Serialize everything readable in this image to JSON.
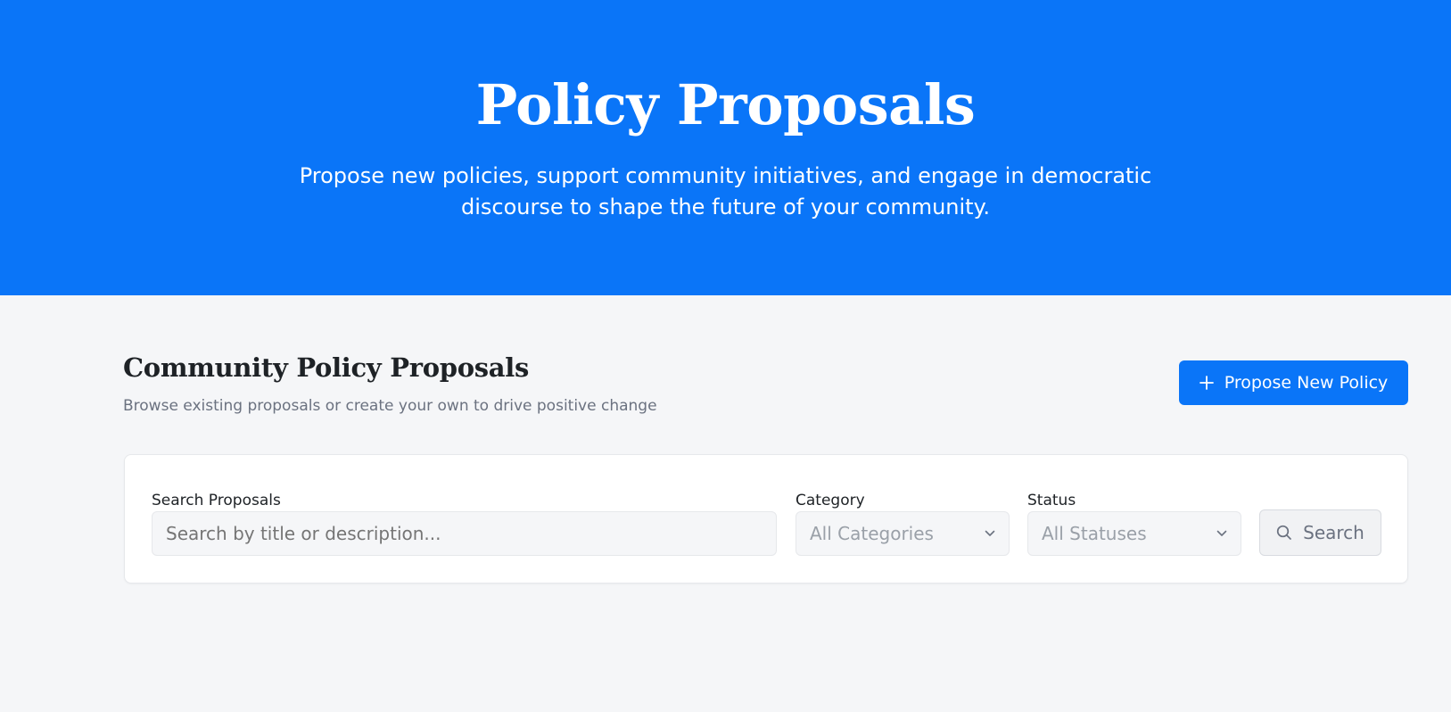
{
  "hero": {
    "title": "Policy Proposals",
    "subtitle": "Propose new policies, support community initiatives, and engage in democratic discourse to shape the future of your community.",
    "background_color": "#0a75f8"
  },
  "section": {
    "title": "Community Policy Proposals",
    "subtitle": "Browse existing proposals or create your own to drive positive change"
  },
  "propose_button": {
    "label": "Propose New Policy",
    "icon": "plus-icon"
  },
  "filters": {
    "search": {
      "label": "Search Proposals",
      "placeholder": "Search by title or description...",
      "value": ""
    },
    "category": {
      "label": "Category",
      "selected": "All Categories",
      "icon": "chevron-down-icon"
    },
    "status": {
      "label": "Status",
      "selected": "All Statuses",
      "icon": "chevron-down-icon"
    },
    "search_button": {
      "label": "Search",
      "icon": "search-icon"
    }
  },
  "colors": {
    "accent": "#0a75f8",
    "page_background": "#f5f6f8",
    "card_background": "#ffffff"
  }
}
